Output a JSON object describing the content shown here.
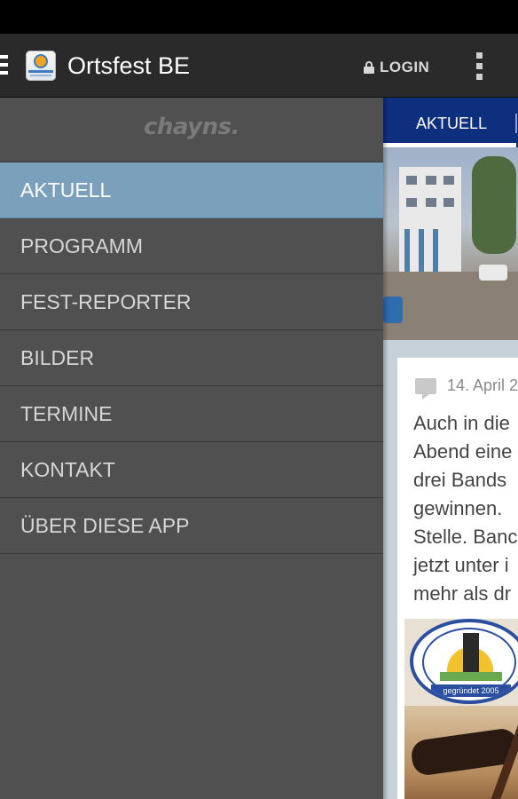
{
  "app": {
    "title": "Ortsfest BE",
    "login_label": "LOGIN",
    "menu_icon": "hamburger-menu-icon",
    "overflow_icon": "more-vert-icon",
    "lock_icon": "lock-icon"
  },
  "drawer": {
    "brand": "chayns.",
    "items": [
      {
        "label": "AKTUELL",
        "active": true
      },
      {
        "label": "PROGRAMM",
        "active": false
      },
      {
        "label": "FEST-REPORTER",
        "active": false
      },
      {
        "label": "BILDER",
        "active": false
      },
      {
        "label": "TERMINE",
        "active": false
      },
      {
        "label": "KONTAKT",
        "active": false
      },
      {
        "label": "ÜBER DIESE APP",
        "active": false
      }
    ]
  },
  "content": {
    "tab_label": "AKTUELL",
    "post": {
      "date": "14. April 2",
      "lines": [
        "Auch in die",
        "Abend eine",
        "drei Bands",
        "gewinnen.",
        "Stelle. Banc",
        "jetzt unter i",
        "mehr als dr"
      ]
    },
    "seal": {
      "banner": "gegründet 2005"
    }
  },
  "colors": {
    "appbar": "#2a2a2a",
    "drawer": "#505050",
    "active_item": "#7ba0bb",
    "tabbar": "#0e2f7e",
    "content_bg": "#c7d1da"
  }
}
